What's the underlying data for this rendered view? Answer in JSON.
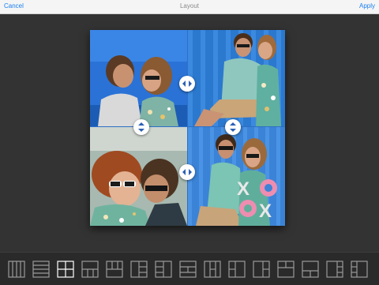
{
  "header": {
    "cancel_label": "Cancel",
    "title": "Layout",
    "apply_label": "Apply",
    "accent_color": "#1a7ef0"
  },
  "collage": {
    "cells": [
      {
        "name": "photo-couple-kissing"
      },
      {
        "name": "photo-couple-sitting-bench"
      },
      {
        "name": "photo-couple-lying-sunglasses"
      },
      {
        "name": "photo-couple-with-xox-letters"
      }
    ],
    "handles": [
      {
        "name": "resize-handle-top-horizontal",
        "icon": "horizontal-arrows-icon"
      },
      {
        "name": "resize-handle-middle-left-vertical",
        "icon": "vertical-arrows-icon"
      },
      {
        "name": "resize-handle-middle-right-vertical",
        "icon": "vertical-arrows-icon"
      },
      {
        "name": "resize-handle-bottom-horizontal",
        "icon": "horizontal-arrows-icon"
      }
    ]
  },
  "layout_options": {
    "selected_index": 2,
    "selected_color": "#ffffff",
    "default_color": "#9a9a9a",
    "items": [
      "four-columns-layout-icon",
      "four-rows-layout-icon",
      "two-by-two-grid-layout-icon",
      "one-top-three-bottom-layout-icon",
      "three-top-one-bottom-layout-icon",
      "one-left-three-right-layout-icon",
      "three-left-one-right-layout-icon",
      "mixed-rows-layout-icon",
      "mixed-columns-layout-icon",
      "left-stack-layout-icon",
      "right-stack-layout-icon",
      "top-stack-layout-icon",
      "bottom-stack-layout-icon",
      "big-left-layout-icon",
      "big-right-layout-icon"
    ]
  }
}
